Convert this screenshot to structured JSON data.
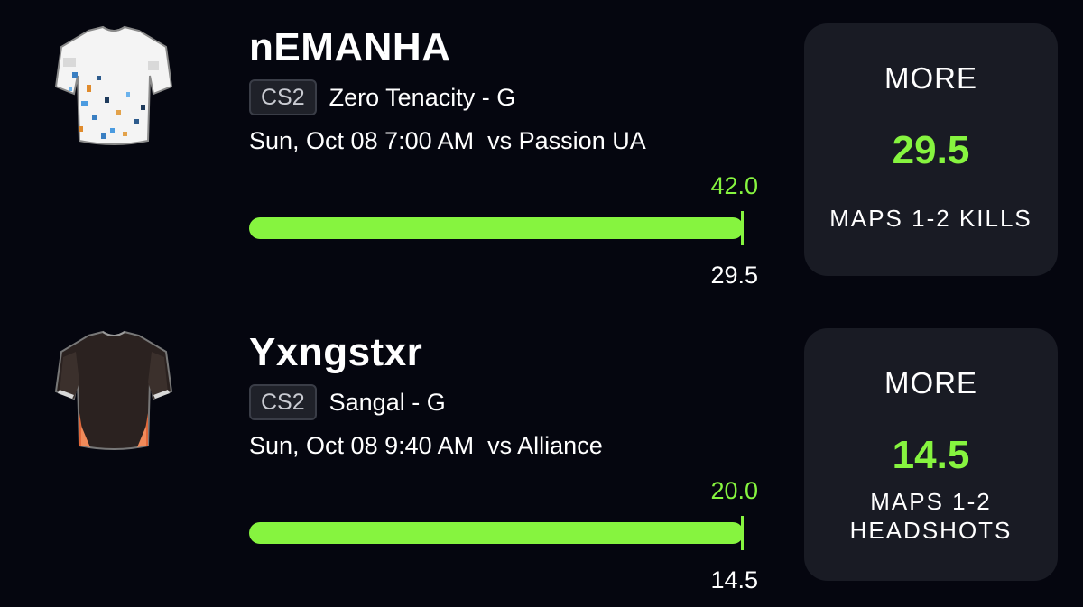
{
  "colors": {
    "background": "#05060f",
    "panel": "#191b24",
    "accent_green": "#86f43f",
    "badge_border": "#3a3d47"
  },
  "cards": [
    {
      "player_name": "nEMANHA",
      "game": "CS2",
      "team": "Zero Tenacity - G",
      "schedule": "Sun, Oct 08 7:00 AM  vs Passion UA",
      "average_value": "42.0",
      "line_value": "29.5",
      "pick": {
        "direction": "MORE",
        "line": "29.5",
        "stat": "MAPS 1-2 KILLS"
      },
      "jersey_icon": "white-jersey-icon"
    },
    {
      "player_name": "Yxngstxr",
      "game": "CS2",
      "team": "Sangal - G",
      "schedule": "Sun, Oct 08 9:40 AM  vs Alliance",
      "average_value": "20.0",
      "line_value": "14.5",
      "pick": {
        "direction": "MORE",
        "line": "14.5",
        "stat": "MAPS 1-2\nHEADSHOTS"
      },
      "jersey_icon": "dark-jersey-icon"
    }
  ]
}
